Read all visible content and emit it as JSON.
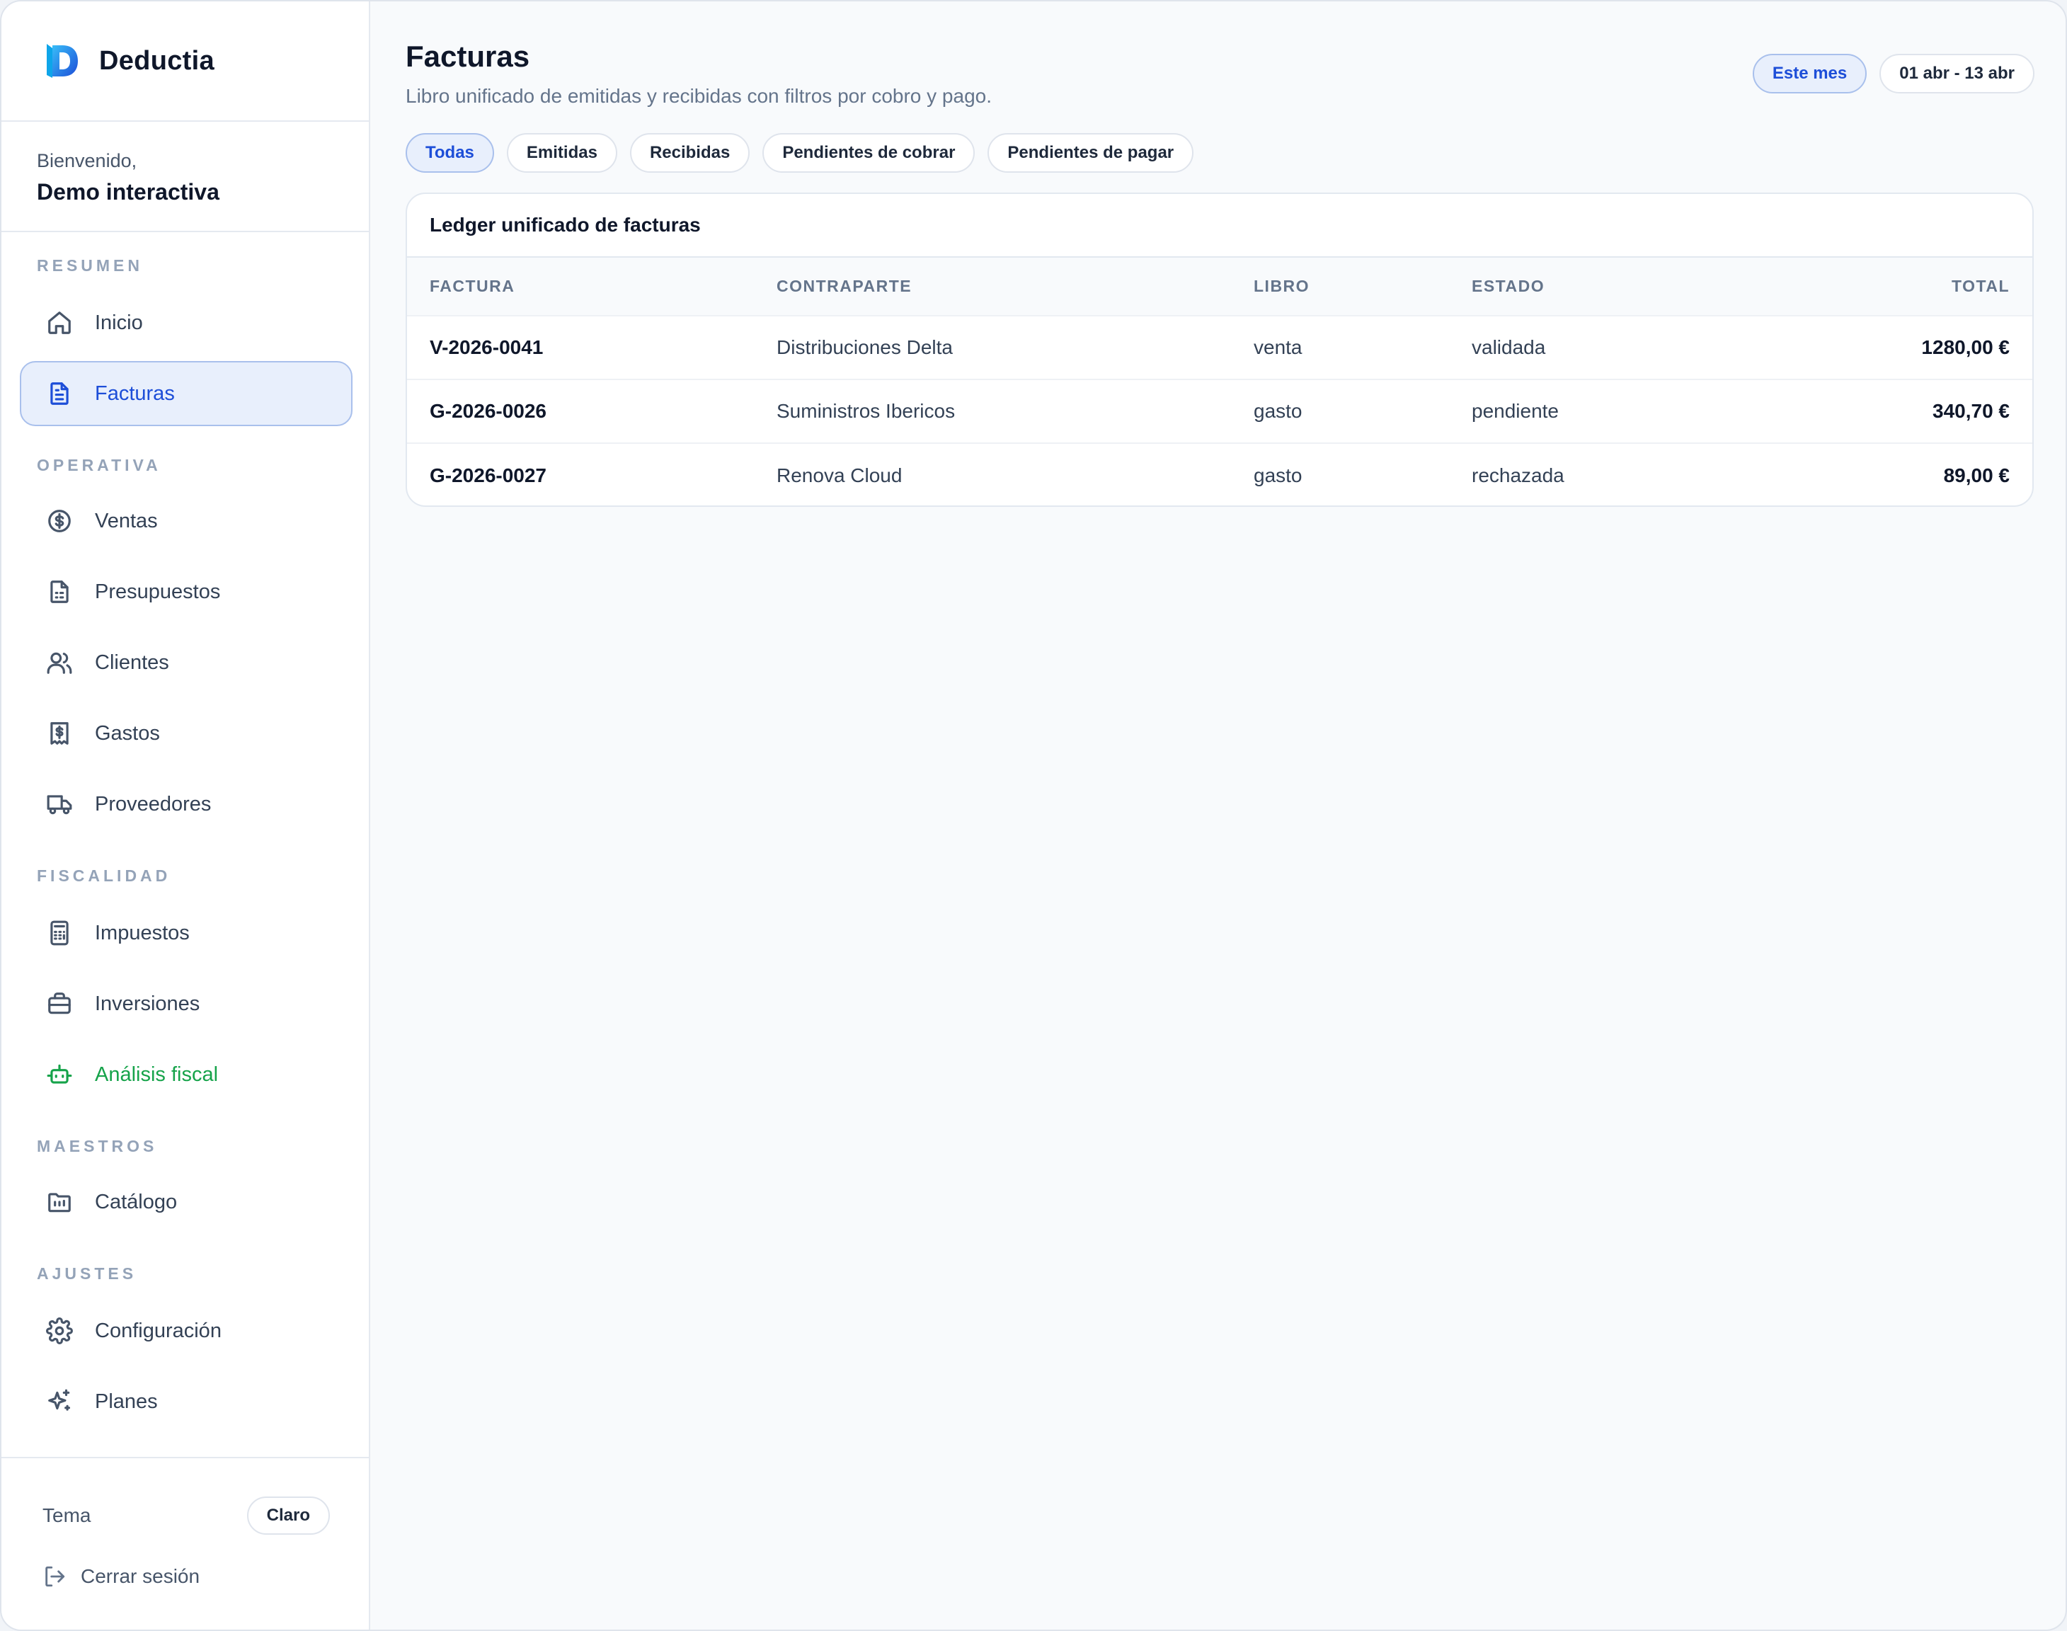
{
  "brand": {
    "name": "Deductia"
  },
  "welcome": {
    "greeting": "Bienvenido,",
    "user": "Demo interactiva"
  },
  "sidebar": {
    "sections": {
      "resumen": "RESUMEN",
      "operativa": "OPERATIVA",
      "fiscalidad": "FISCALIDAD",
      "maestros": "MAESTROS",
      "ajustes": "AJUSTES"
    },
    "items": {
      "inicio": "Inicio",
      "facturas": "Facturas",
      "ventas": "Ventas",
      "presupuestos": "Presupuestos",
      "clientes": "Clientes",
      "gastos": "Gastos",
      "proveedores": "Proveedores",
      "impuestos": "Impuestos",
      "inversiones": "Inversiones",
      "analisis_fiscal": "Análisis fiscal",
      "catalogo": "Catálogo",
      "configuracion": "Configuración",
      "planes": "Planes"
    },
    "active": "facturas",
    "theme_label": "Tema",
    "theme_value": "Claro",
    "logout": "Cerrar sesión"
  },
  "header": {
    "title": "Facturas",
    "subtitle": "Libro unificado de emitidas y recibidas con filtros por cobro y pago.",
    "period_label": "Este mes",
    "period_range": "01 abr - 13 abr"
  },
  "filters": [
    "Todas",
    "Emitidas",
    "Recibidas",
    "Pendientes de cobrar",
    "Pendientes de pagar"
  ],
  "active_filter": "Todas",
  "ledger": {
    "title": "Ledger unificado de facturas",
    "columns": {
      "factura": "FACTURA",
      "contraparte": "CONTRAPARTE",
      "libro": "LIBRO",
      "estado": "ESTADO",
      "total": "TOTAL"
    },
    "rows": [
      {
        "factura": "V-2026-0041",
        "contraparte": "Distribuciones Delta",
        "libro": "venta",
        "estado": "validada",
        "total": "1280,00 €"
      },
      {
        "factura": "G-2026-0026",
        "contraparte": "Suministros Ibericos",
        "libro": "gasto",
        "estado": "pendiente",
        "total": "340,70 €"
      },
      {
        "factura": "G-2026-0027",
        "contraparte": "Renova Cloud",
        "libro": "gasto",
        "estado": "rechazada",
        "total": "89,00 €"
      }
    ]
  },
  "colors": {
    "accent": "#1d4ed8",
    "accent_bg": "#e8effc",
    "green": "#16a34a"
  }
}
